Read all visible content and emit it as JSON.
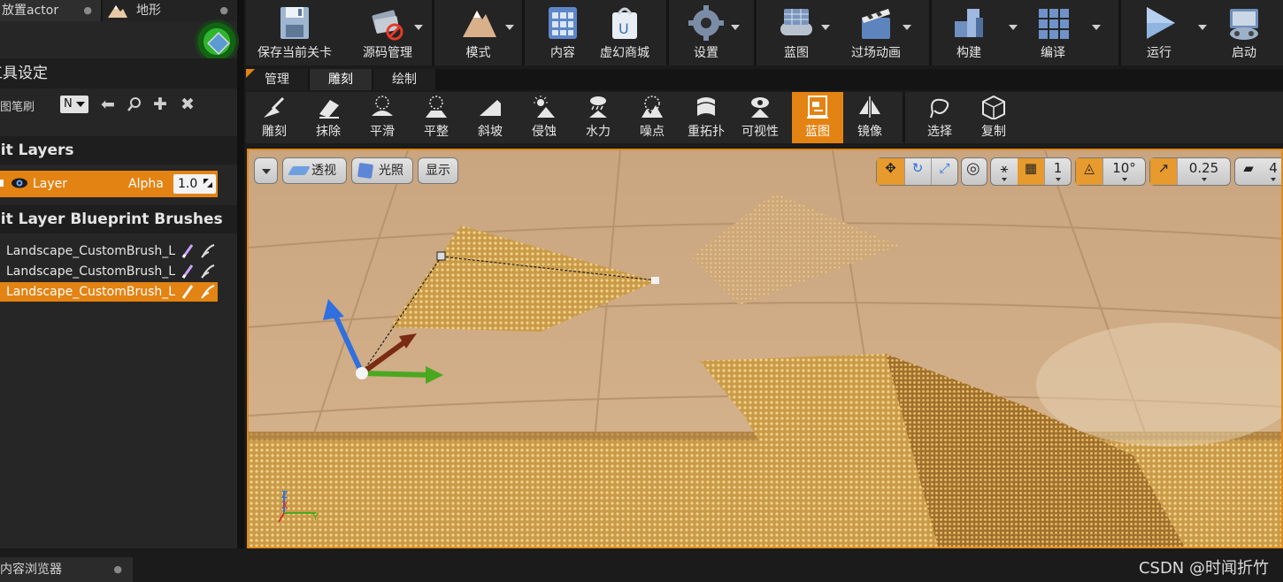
{
  "left_panel": {
    "tabs": [
      {
        "label": "放置actor"
      },
      {
        "label": "地形"
      }
    ],
    "tool_settings_header": "工具设定",
    "brush_label": "地图笔刷",
    "brush_value": "N",
    "edit_layers_header": "Edit Layers",
    "layer": {
      "name": "Layer",
      "alpha_label": "Alpha",
      "alpha_value": "1.0"
    },
    "blueprint_brushes_header": "Edit Layer Blueprint Brushes",
    "blueprint_brushes": [
      {
        "name": "Landscape_CustomBrush_L",
        "selected": false
      },
      {
        "name": "Landscape_CustomBrush_L",
        "selected": false
      },
      {
        "name": "Landscape_CustomBrush_L",
        "selected": true
      }
    ]
  },
  "toolbar": {
    "buttons": [
      {
        "label": "保存当前关卡",
        "icon": "save-icon"
      },
      {
        "label": "源码管理",
        "icon": "source-control-icon"
      },
      {
        "label": "模式",
        "icon": "modes-icon"
      },
      {
        "label": "内容",
        "icon": "content-icon"
      },
      {
        "label": "虚幻商城",
        "icon": "marketplace-icon"
      },
      {
        "label": "设置",
        "icon": "settings-icon"
      },
      {
        "label": "蓝图",
        "icon": "blueprint-icon"
      },
      {
        "label": "过场动画",
        "icon": "cinematics-icon"
      },
      {
        "label": "构建",
        "icon": "build-icon"
      },
      {
        "label": "编译",
        "icon": "compile-icon"
      },
      {
        "label": "运行",
        "icon": "play-icon"
      },
      {
        "label": "启动",
        "icon": "launch-icon"
      }
    ]
  },
  "mode_tabs": [
    {
      "label": "管理"
    },
    {
      "label": "雕刻",
      "active": true
    },
    {
      "label": "绘制"
    }
  ],
  "sculpt_tools": [
    {
      "label": "雕刻",
      "icon": "sculpt-icon"
    },
    {
      "label": "抹除",
      "icon": "erase-icon"
    },
    {
      "label": "平滑",
      "icon": "smooth-icon"
    },
    {
      "label": "平整",
      "icon": "flatten-icon"
    },
    {
      "label": "斜坡",
      "icon": "ramp-icon"
    },
    {
      "label": "侵蚀",
      "icon": "erosion-icon"
    },
    {
      "label": "水力",
      "icon": "hydro-icon"
    },
    {
      "label": "噪点",
      "icon": "noise-icon"
    },
    {
      "label": "重拓扑",
      "icon": "retopologize-icon"
    },
    {
      "label": "可视性",
      "icon": "visibility-icon"
    },
    {
      "label": "蓝图",
      "icon": "blueprint-brush-icon",
      "active": true
    },
    {
      "label": "镜像",
      "icon": "mirror-icon"
    },
    {
      "label": "选择",
      "icon": "select-icon"
    },
    {
      "label": "复制",
      "icon": "copy-icon"
    }
  ],
  "viewport": {
    "perspective_label": "透视",
    "lighting_label": "光照",
    "show_label": "显示",
    "grid_size": "1",
    "rotation_snap": "10°",
    "scale_snap": "0.25",
    "camera_speed": "4"
  },
  "bottom": {
    "content_browser_tab": "内容浏览器",
    "watermark": "CSDN @时闻折竹"
  },
  "colors": {
    "accent": "#e38313",
    "panel": "#262626",
    "terrain": "#c9a77e"
  }
}
